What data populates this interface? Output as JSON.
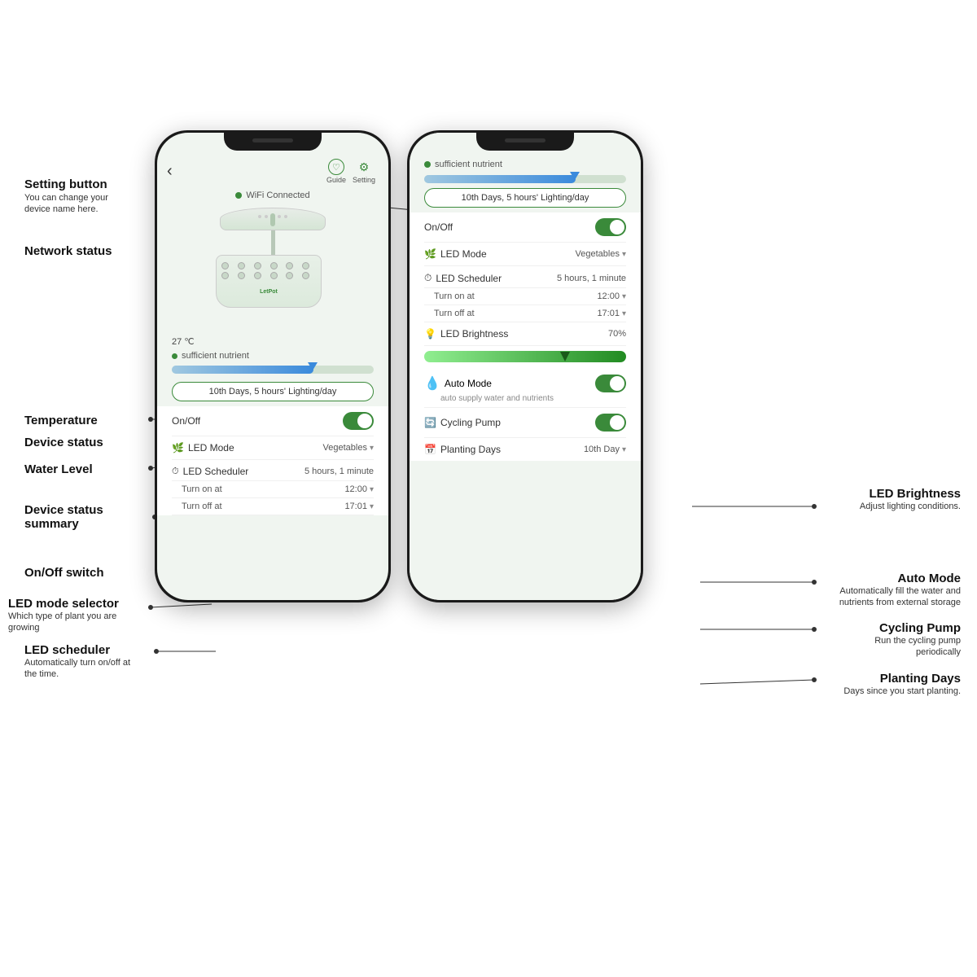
{
  "page": {
    "background": "#ffffff"
  },
  "annotations": {
    "setting_button": {
      "title": "Setting button",
      "desc": "You can change your device name here."
    },
    "network_status": {
      "title": "Network status"
    },
    "temperature": {
      "title": "Temperature"
    },
    "device_status": {
      "title": "Device status"
    },
    "water_level": {
      "title": "Water Level"
    },
    "device_status_summary": {
      "title": "Device status summary"
    },
    "onoff_switch": {
      "title": "On/Off switch"
    },
    "led_mode_selector": {
      "title": "LED mode selector",
      "desc": "Which type of plant you are growing"
    },
    "led_scheduler": {
      "title": "LED scheduler",
      "desc": "Automatically turn on/off at the time."
    },
    "led_brightness": {
      "title": "LED Brightness",
      "desc": "Adjust lighting conditions."
    },
    "auto_mode": {
      "title": "Auto Mode",
      "desc": "Automatically fill the water and nutrients from external storage"
    },
    "cycling_pump": {
      "title": "Cycling Pump",
      "desc": "Run the cycling pump periodically"
    },
    "planting_days": {
      "title": "Planting Days",
      "desc": "Days since you start planting."
    }
  },
  "phone1": {
    "back_btn": "‹",
    "guide_label": "Guide",
    "setting_label": "Setting",
    "wifi_status": "WiFi Connected",
    "temperature": "27 ℃",
    "device_status_text": "sufficient nutrient",
    "summary_text": "10th Days, 5 hours' Lighting/day",
    "onoff_label": "On/Off",
    "led_mode_label": "LED Mode",
    "led_mode_value": "Vegetables",
    "led_scheduler_label": "LED Scheduler",
    "led_scheduler_value": "5 hours, 1 minute",
    "turn_on_label": "Turn on at",
    "turn_on_value": "12:00",
    "turn_off_label": "Turn off at",
    "turn_off_value": "17:01",
    "letpot_text": "LetPot"
  },
  "phone2": {
    "partial_status": "sufficient nutrient",
    "summary_text": "10th Days, 5 hours' Lighting/day",
    "onoff_label": "On/Off",
    "led_mode_label": "LED Mode",
    "led_mode_value": "Vegetables",
    "led_scheduler_label": "LED Scheduler",
    "led_scheduler_value": "5 hours, 1 minute",
    "turn_on_label": "Turn on at",
    "turn_on_value": "12:00",
    "turn_off_label": "Turn off at",
    "turn_off_value": "17:01",
    "led_brightness_label": "LED Brightness",
    "led_brightness_value": "70%",
    "auto_mode_label": "Auto Mode",
    "auto_mode_desc": "auto supply water and nutrients",
    "cycling_pump_label": "Cycling Pump",
    "planting_days_label": "Planting Days",
    "planting_days_value": "10th Day"
  }
}
